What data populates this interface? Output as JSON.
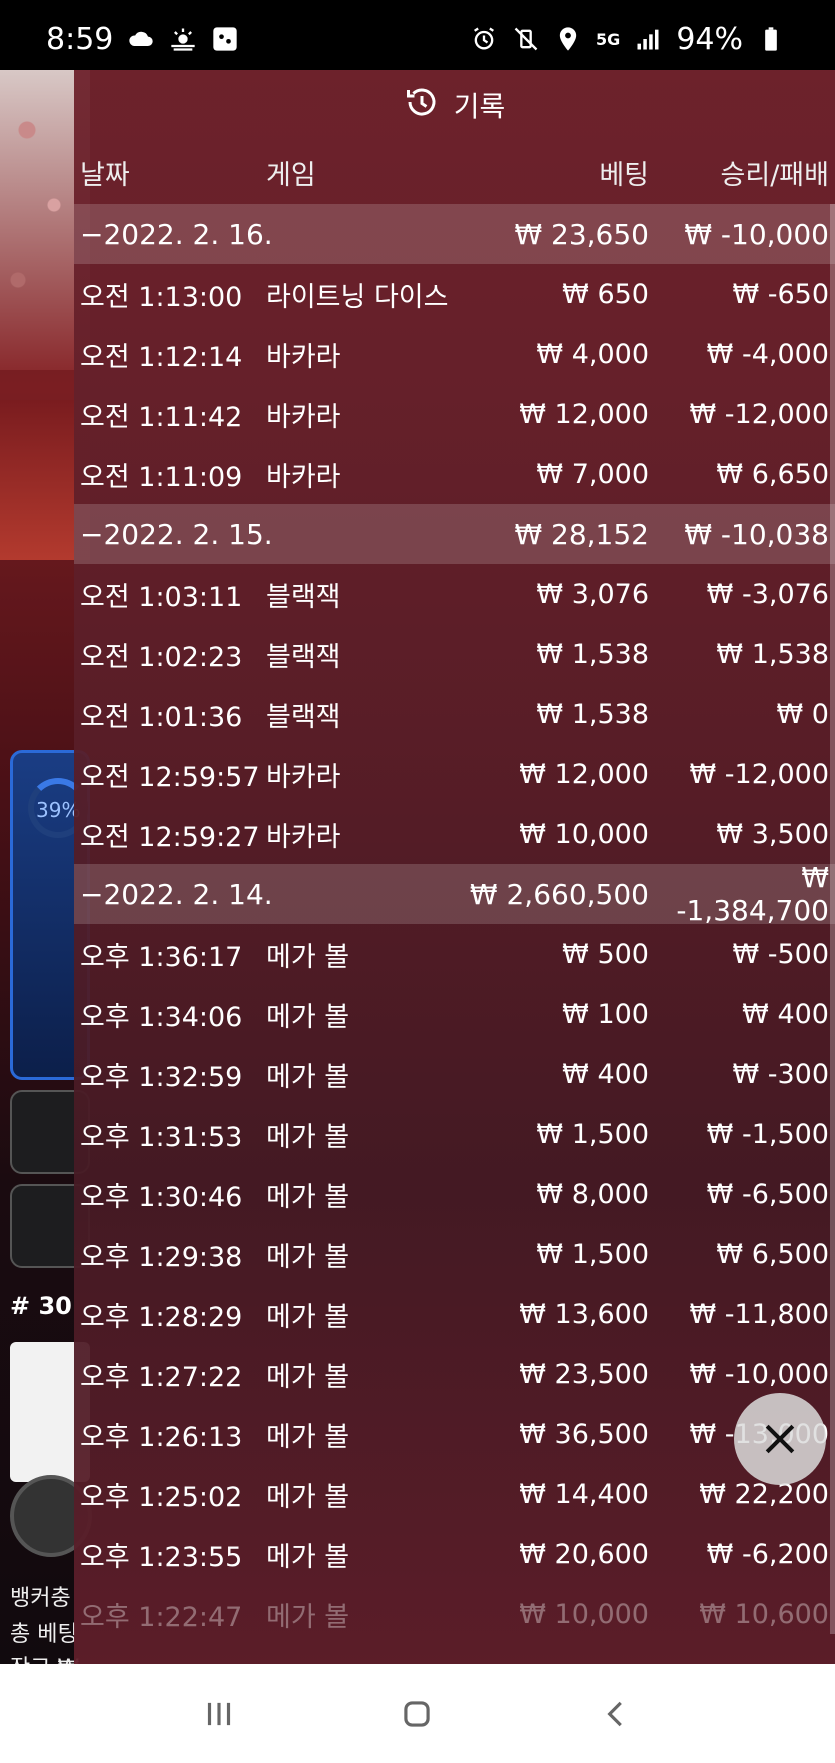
{
  "status_bar": {
    "time": "8:59",
    "battery": "94%",
    "network": "5G"
  },
  "background": {
    "progress_percent": "39%",
    "round_label": "# 30",
    "info_lines": [
      "뱅커충",
      "총 베팅",
      "잔고 ₩"
    ]
  },
  "history": {
    "title": "기록",
    "columns": {
      "date": "날짜",
      "game": "게임",
      "bet": "베팅",
      "win": "승리/패배"
    },
    "groups": [
      {
        "date": "−2022. 2. 16.",
        "total_bet": "₩ 23,650",
        "total_win": "₩ -10,000",
        "rows": [
          {
            "time": "오전 1:13:00",
            "game": "라이트닝 다이스",
            "bet": "₩ 650",
            "win": "₩ -650"
          },
          {
            "time": "오전 1:12:14",
            "game": "바카라",
            "bet": "₩ 4,000",
            "win": "₩ -4,000"
          },
          {
            "time": "오전 1:11:42",
            "game": "바카라",
            "bet": "₩ 12,000",
            "win": "₩ -12,000"
          },
          {
            "time": "오전 1:11:09",
            "game": "바카라",
            "bet": "₩ 7,000",
            "win": "₩ 6,650"
          }
        ]
      },
      {
        "date": "−2022. 2. 15.",
        "total_bet": "₩ 28,152",
        "total_win": "₩ -10,038",
        "rows": [
          {
            "time": "오전 1:03:11",
            "game": "블랙잭",
            "bet": "₩ 3,076",
            "win": "₩ -3,076"
          },
          {
            "time": "오전 1:02:23",
            "game": "블랙잭",
            "bet": "₩ 1,538",
            "win": "₩ 1,538"
          },
          {
            "time": "오전 1:01:36",
            "game": "블랙잭",
            "bet": "₩ 1,538",
            "win": "₩ 0"
          },
          {
            "time": "오전 12:59:57",
            "game": "바카라",
            "bet": "₩ 12,000",
            "win": "₩ -12,000"
          },
          {
            "time": "오전 12:59:27",
            "game": "바카라",
            "bet": "₩ 10,000",
            "win": "₩ 3,500"
          }
        ]
      },
      {
        "date": "−2022. 2. 14.",
        "total_bet": "₩ 2,660,500",
        "total_win": "₩ -1,384,700",
        "rows": [
          {
            "time": "오후 1:36:17",
            "game": "메가 볼",
            "bet": "₩ 500",
            "win": "₩ -500"
          },
          {
            "time": "오후 1:34:06",
            "game": "메가 볼",
            "bet": "₩ 100",
            "win": "₩ 400"
          },
          {
            "time": "오후 1:32:59",
            "game": "메가 볼",
            "bet": "₩ 400",
            "win": "₩ -300"
          },
          {
            "time": "오후 1:31:53",
            "game": "메가 볼",
            "bet": "₩ 1,500",
            "win": "₩ -1,500"
          },
          {
            "time": "오후 1:30:46",
            "game": "메가 볼",
            "bet": "₩ 8,000",
            "win": "₩ -6,500"
          },
          {
            "time": "오후 1:29:38",
            "game": "메가 볼",
            "bet": "₩ 1,500",
            "win": "₩ 6,500"
          },
          {
            "time": "오후 1:28:29",
            "game": "메가 볼",
            "bet": "₩ 13,600",
            "win": "₩ -11,800"
          },
          {
            "time": "오후 1:27:22",
            "game": "메가 볼",
            "bet": "₩ 23,500",
            "win": "₩ -10,000"
          },
          {
            "time": "오후 1:26:13",
            "game": "메가 볼",
            "bet": "₩ 36,500",
            "win": "₩ -13,000"
          },
          {
            "time": "오후 1:25:02",
            "game": "메가 볼",
            "bet": "₩ 14,400",
            "win": "₩ 22,200"
          },
          {
            "time": "오후 1:23:55",
            "game": "메가 볼",
            "bet": "₩ 20,600",
            "win": "₩ -6,200"
          },
          {
            "time": "오후 1:22:47",
            "game": "메가 볼",
            "bet": "₩ 10,000",
            "win": "₩ 10,600"
          }
        ]
      }
    ]
  },
  "icons": {
    "history": "history-icon",
    "close": "close-icon",
    "nav": [
      "recent-apps-icon",
      "home-icon",
      "back-icon"
    ]
  }
}
